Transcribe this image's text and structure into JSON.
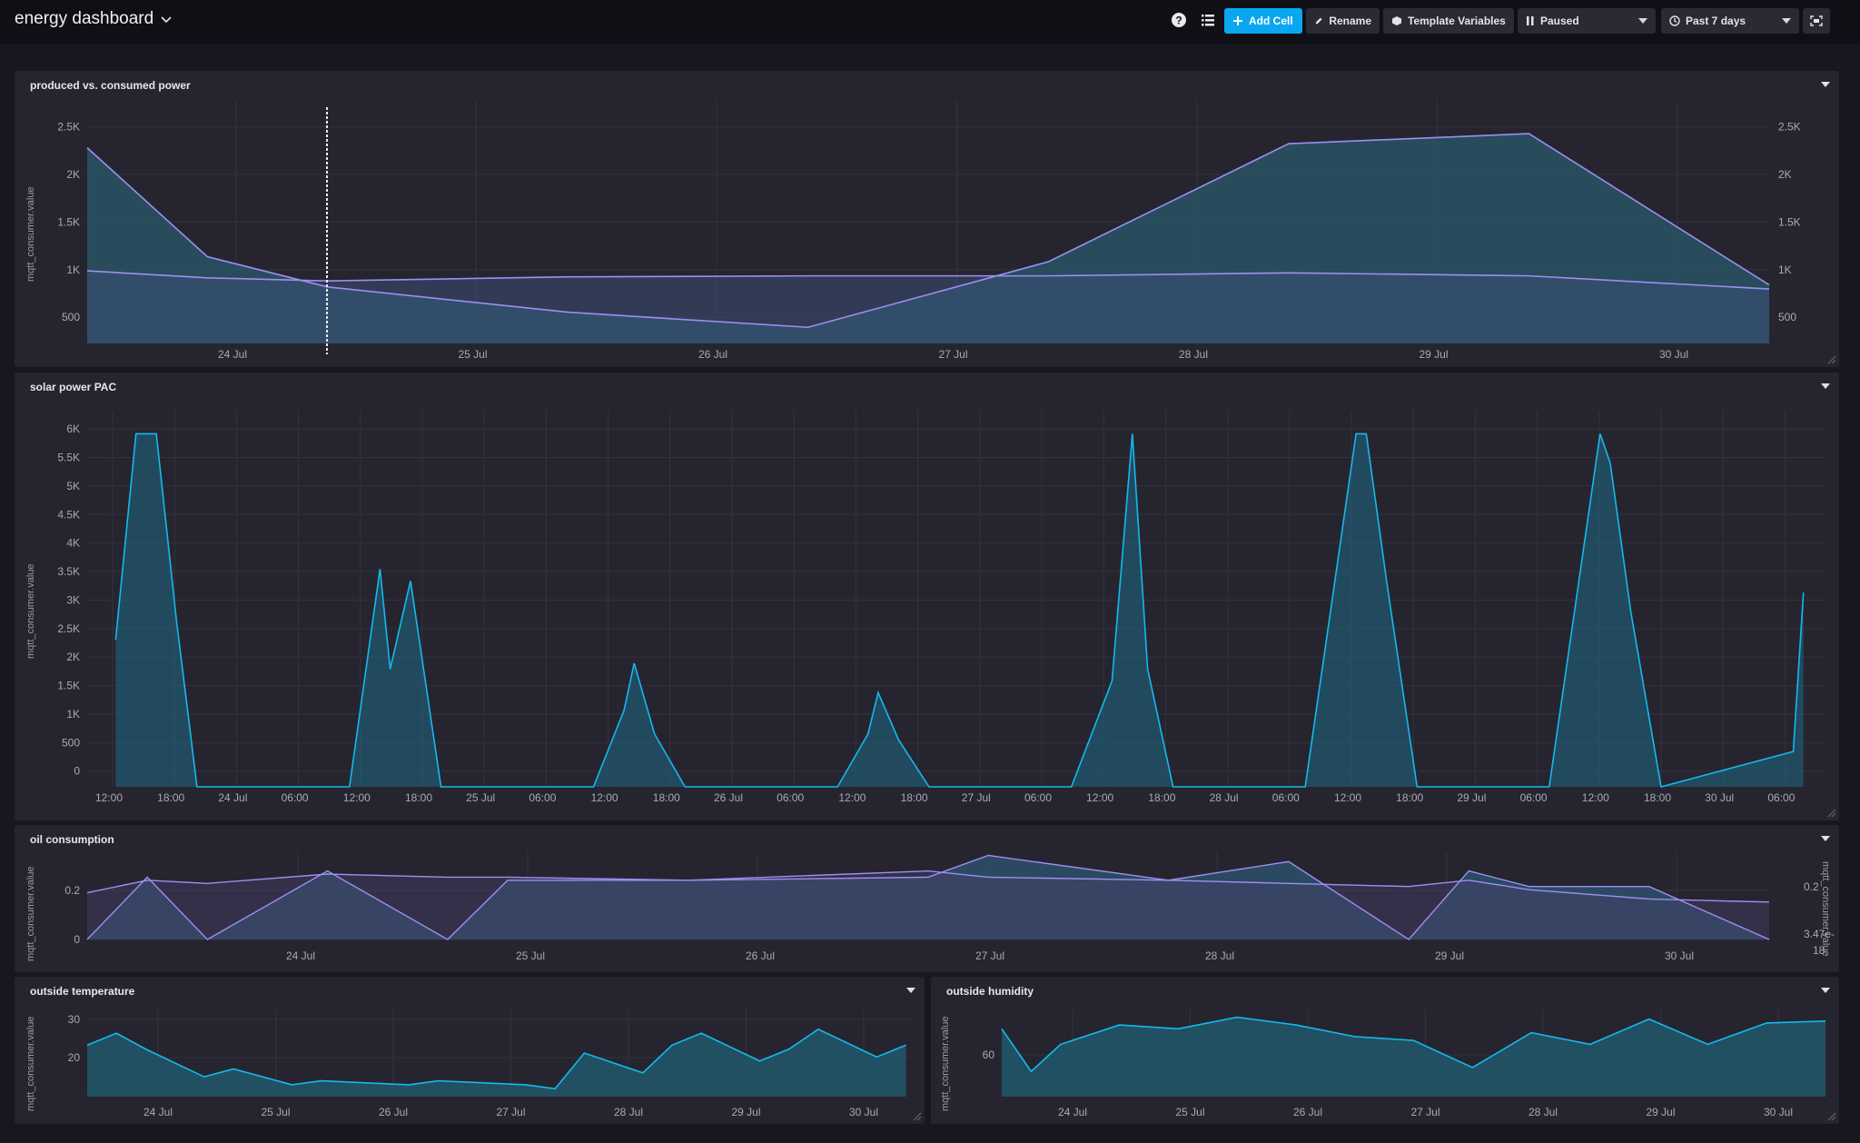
{
  "dashboard": {
    "title": "energy dashboard"
  },
  "toolbar": {
    "add_cell": "Add Cell",
    "rename": "Rename",
    "template_variables": "Template Variables",
    "paused": "Paused",
    "time_range": "Past 7 days"
  },
  "colors": {
    "primary": "#0aa7f0",
    "purple_line": "#9c8ff2",
    "cyan_line": "#14b9ef",
    "fill": "#2b5766"
  },
  "cells": {
    "produced": {
      "title": "produced vs. consumed power",
      "ylabel": "mqtt_consumer.value",
      "yticks": [
        "2.5K",
        "2K",
        "1.5K",
        "1K",
        "500"
      ],
      "xticks": [
        "24 Jul",
        "25 Jul",
        "26 Jul",
        "27 Jul",
        "28 Jul",
        "29 Jul",
        "30 Jul"
      ],
      "chart_data": {
        "type": "area",
        "ylim": [
          340,
          2700
        ],
        "x": [
          "23 Jul 12:00",
          "24 Jul 00:00",
          "24 Jul 12:00",
          "25 Jul 12:00",
          "26 Jul 12:00",
          "27 Jul 12:00",
          "28 Jul 12:00",
          "29 Jul 12:00",
          "30 Jul 12:00"
        ],
        "series": [
          {
            "values": [
              2280,
              1200,
              900,
              650,
              500,
              1150,
              2320,
              2420,
              920
            ]
          },
          {
            "values": [
              1060,
              990,
              960,
              1000,
              1010,
              1010,
              1040,
              1010,
              880
            ]
          }
        ]
      }
    },
    "solar": {
      "title": "solar power PAC",
      "ylabel": "mqtt_consumer.value",
      "yticks": [
        "6K",
        "5.5K",
        "5K",
        "4.5K",
        "4K",
        "3.5K",
        "3K",
        "2.5K",
        "2K",
        "1.5K",
        "1K",
        "500",
        "0"
      ],
      "xticks": [
        "12:00",
        "18:00",
        "24 Jul",
        "06:00",
        "12:00",
        "18:00",
        "25 Jul",
        "06:00",
        "12:00",
        "18:00",
        "26 Jul",
        "06:00",
        "12:00",
        "18:00",
        "27 Jul",
        "06:00",
        "12:00",
        "18:00",
        "28 Jul",
        "06:00",
        "12:00",
        "18:00",
        "29 Jul",
        "06:00",
        "12:00",
        "18:00",
        "30 Jul",
        "06:00"
      ],
      "chart_data": {
        "type": "area",
        "ylim": [
          0,
          6300
        ],
        "x": [
          "23 Jul 10:00",
          "23 Jul 12:00",
          "23 Jul 14:00",
          "23 Jul 16:00",
          "23 Jul 18:00",
          "24 Jul 09:00",
          "24 Jul 12:00",
          "24 Jul 13:00",
          "24 Jul 15:00",
          "24 Jul 18:00",
          "25 Jul 09:00",
          "25 Jul 12:00",
          "25 Jul 13:00",
          "25 Jul 15:00",
          "25 Jul 18:00",
          "26 Jul 09:00",
          "26 Jul 12:00",
          "26 Jul 13:00",
          "26 Jul 15:00",
          "26 Jul 18:00",
          "27 Jul 08:00",
          "27 Jul 12:00",
          "27 Jul 14:00",
          "27 Jul 15:30",
          "27 Jul 18:00",
          "28 Jul 07:00",
          "28 Jul 12:00",
          "28 Jul 13:00",
          "28 Jul 15:00",
          "28 Jul 18:00",
          "29 Jul 07:00",
          "29 Jul 12:00",
          "29 Jul 13:00",
          "29 Jul 15:00",
          "29 Jul 18:00",
          "30 Jul 07:00",
          "30 Jul 08:00"
        ],
        "series": [
          {
            "values": [
              2500,
              6000,
              6000,
              2800,
              0,
              0,
              3700,
              2000,
              3500,
              0,
              0,
              1300,
              2100,
              900,
              0,
              0,
              900,
              1600,
              800,
              0,
              0,
              1800,
              6000,
              2000,
              0,
              0,
              6000,
              6000,
              3500,
              0,
              0,
              6000,
              5500,
              3000,
              0,
              600,
              3300
            ]
          }
        ]
      }
    },
    "oil": {
      "title": "oil consumption",
      "ylabel": "mqtt_consumer.value",
      "yticks": [
        "0.2",
        "0"
      ],
      "y2ticks": [
        "0.2",
        "3.47e-",
        "18"
      ],
      "xticks": [
        "24 Jul",
        "25 Jul",
        "26 Jul",
        "27 Jul",
        "28 Jul",
        "29 Jul",
        "30 Jul"
      ],
      "chart_data": {
        "type": "area",
        "ylim": [
          0,
          0.28
        ],
        "x": [
          "23 Jul 12:00",
          "23 Jul 18:00",
          "24 Jul 00:00",
          "24 Jul 12:00",
          "25 Jul 00:00",
          "25 Jul 06:00",
          "26 Jul 00:00",
          "27 Jul 00:00",
          "27 Jul 06:00",
          "28 Jul 00:00",
          "28 Jul 12:00",
          "29 Jul 00:00",
          "29 Jul 06:00",
          "29 Jul 12:00",
          "30 Jul 00:00",
          "30 Jul 12:00"
        ],
        "series": [
          {
            "values": [
              0.15,
              0.19,
              0.18,
              0.21,
              0.2,
              0.2,
              0.19,
              0.22,
              0.2,
              0.19,
              0.18,
              0.17,
              0.19,
              0.16,
              0.13,
              0.12
            ]
          },
          {
            "values": [
              0,
              0.2,
              0.0,
              0.22,
              0.0,
              0.19,
              0.19,
              0.2,
              0.27,
              0.19,
              0.25,
              0.0,
              0.22,
              0.17,
              0.17,
              0.0
            ]
          }
        ]
      }
    },
    "temperature": {
      "title": "outside temperature",
      "ylabel": "mqtt_consumer.value",
      "yticks": [
        "30",
        "20"
      ],
      "xticks": [
        "24 Jul",
        "25 Jul",
        "26 Jul",
        "27 Jul",
        "28 Jul",
        "29 Jul",
        "30 Jul"
      ],
      "chart_data": {
        "type": "area",
        "ylim": [
          11,
          33
        ],
        "x": [
          "23 Jul 12:00",
          "23 Jul 18:00",
          "24 Jul 00:00",
          "24 Jul 12:00",
          "24 Jul 18:00",
          "25 Jul 06:00",
          "25 Jul 12:00",
          "26 Jul 06:00",
          "26 Jul 12:00",
          "27 Jul 06:00",
          "27 Jul 12:00",
          "27 Jul 18:00",
          "28 Jul 06:00",
          "28 Jul 12:00",
          "28 Jul 18:00",
          "29 Jul 06:00",
          "29 Jul 12:00",
          "29 Jul 18:00",
          "30 Jul 06:00",
          "30 Jul 12:00"
        ],
        "series": [
          {
            "values": [
              24,
              27,
              23,
              16,
              18,
              14,
              15,
              14,
              15,
              14,
              13,
              22,
              17,
              24,
              27,
              20,
              23,
              28,
              21,
              24
            ]
          }
        ]
      }
    },
    "humidity": {
      "title": "outside humidity",
      "ylabel": "mqtt_consumer.value",
      "yticks": [
        "60"
      ],
      "xticks": [
        "24 Jul",
        "25 Jul",
        "26 Jul",
        "27 Jul",
        "28 Jul",
        "29 Jul",
        "30 Jul"
      ],
      "chart_data": {
        "type": "area",
        "ylim": [
          35,
          80
        ],
        "x": [
          "23 Jul 12:00",
          "23 Jul 18:00",
          "24 Jul 00:00",
          "24 Jul 12:00",
          "25 Jul 00:00",
          "25 Jul 12:00",
          "26 Jul 00:00",
          "26 Jul 12:00",
          "27 Jul 00:00",
          "27 Jul 12:00",
          "28 Jul 00:00",
          "28 Jul 12:00",
          "29 Jul 00:00",
          "29 Jul 12:00",
          "30 Jul 00:00",
          "30 Jul 12:00"
        ],
        "series": [
          {
            "values": [
              70,
              48,
              62,
              72,
              70,
              76,
              72,
              66,
              64,
              50,
              68,
              62,
              75,
              62,
              73,
              74
            ]
          }
        ]
      }
    }
  }
}
